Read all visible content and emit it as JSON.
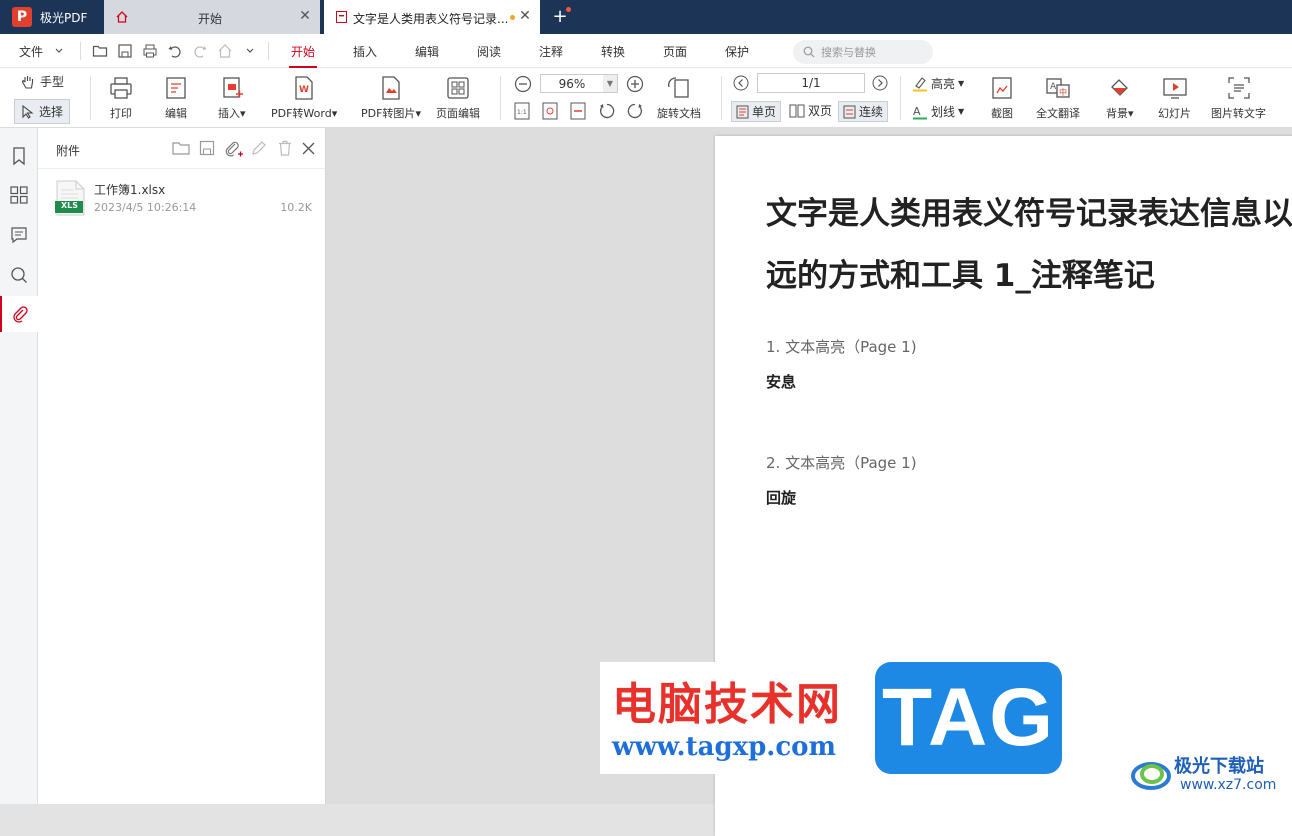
{
  "titlebar": {
    "app_name": "极光PDF",
    "tabs": [
      {
        "label": "开始"
      },
      {
        "label": "文字是人类用表义符号记录..."
      }
    ]
  },
  "menubar": {
    "file": "文件",
    "items": [
      "开始",
      "插入",
      "编辑",
      "阅读",
      "注释",
      "转换",
      "页面",
      "保护"
    ],
    "active": "开始",
    "search_placeholder": "搜索与替换"
  },
  "ribbon": {
    "hand": "手型",
    "select": "选择",
    "print": "打印",
    "edit": "编辑",
    "insert": "插入",
    "pdf_to_word": "PDF转Word",
    "pdf_to_image": "PDF转图片",
    "page_edit": "页面编辑",
    "zoom": "96%",
    "rotate_doc": "旋转文档",
    "page_number": "1/1",
    "single_page": "单页",
    "double_page": "双页",
    "continuous": "连续",
    "highlight": "高亮",
    "underline": "划线",
    "screenshot": "截图",
    "full_translate": "全文翻译",
    "background": "背景",
    "slideshow": "幻灯片",
    "image_to_text": "图片转文字"
  },
  "attachments": {
    "title": "附件",
    "files": [
      {
        "name": "工作簿1.xlsx",
        "date": "2023/4/5 10:26:14",
        "size": "10.2K",
        "type": "XLS"
      }
    ]
  },
  "document": {
    "title_line1": "文字是人类用表义符号记录表达信息以",
    "title_line2": "远的方式和工具 1_注释笔记",
    "notes": [
      {
        "heading": "1. 文本高亮（Page 1)",
        "text": "安息"
      },
      {
        "heading": "2. 文本高亮（Page 1)",
        "text": "回旋"
      }
    ]
  },
  "watermark": {
    "cn": "电脑技术网",
    "url": "www.tagxp.com",
    "tag": "TAG",
    "brand_cn": "极光下载站",
    "brand_url": "www.xz7.com"
  },
  "colors": {
    "accent": "#d0021b",
    "titlebar": "#1c3556",
    "tag_blue": "#1e88e5",
    "watermark_red": "#e8312a"
  }
}
